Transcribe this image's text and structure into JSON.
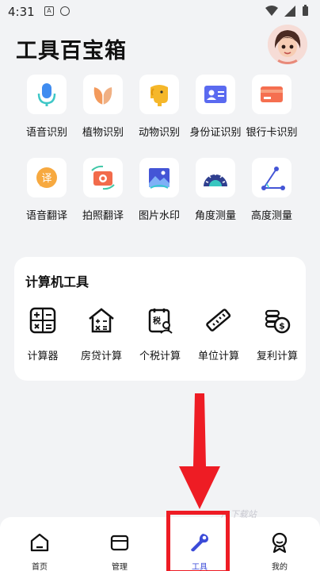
{
  "status": {
    "time": "4:31"
  },
  "header": {
    "title": "工具百宝箱"
  },
  "tools": [
    {
      "label": "语音识别",
      "icon": "microphone-icon"
    },
    {
      "label": "植物识别",
      "icon": "leaf-icon"
    },
    {
      "label": "动物识别",
      "icon": "elephant-icon"
    },
    {
      "label": "身份证识别",
      "icon": "id-card-icon"
    },
    {
      "label": "银行卡识别",
      "icon": "bank-card-icon"
    },
    {
      "label": "语音翻译",
      "icon": "voice-translate-icon"
    },
    {
      "label": "拍照翻译",
      "icon": "camera-translate-icon"
    },
    {
      "label": "图片水印",
      "icon": "image-watermark-icon"
    },
    {
      "label": "角度测量",
      "icon": "protractor-icon"
    },
    {
      "label": "高度测量",
      "icon": "height-measure-icon"
    }
  ],
  "calculator": {
    "title": "计算机工具",
    "items": [
      {
        "label": "计算器",
        "icon": "calculator-icon"
      },
      {
        "label": "房贷计算",
        "icon": "house-loan-icon"
      },
      {
        "label": "个税计算",
        "icon": "tax-icon"
      },
      {
        "label": "单位计算",
        "icon": "ruler-icon"
      },
      {
        "label": "复利计算",
        "icon": "coins-icon"
      }
    ],
    "badge_text": "税"
  },
  "nav": {
    "items": [
      {
        "label": "首页",
        "icon": "home-icon"
      },
      {
        "label": "管理",
        "icon": "folder-icon"
      },
      {
        "label": "工具",
        "icon": "wrench-icon",
        "active": true
      },
      {
        "label": "我的",
        "icon": "profile-icon"
      }
    ]
  },
  "watermark": "/8下载站",
  "colors": {
    "accent": "#3b4bd8",
    "annotation": "#ee1c24"
  }
}
